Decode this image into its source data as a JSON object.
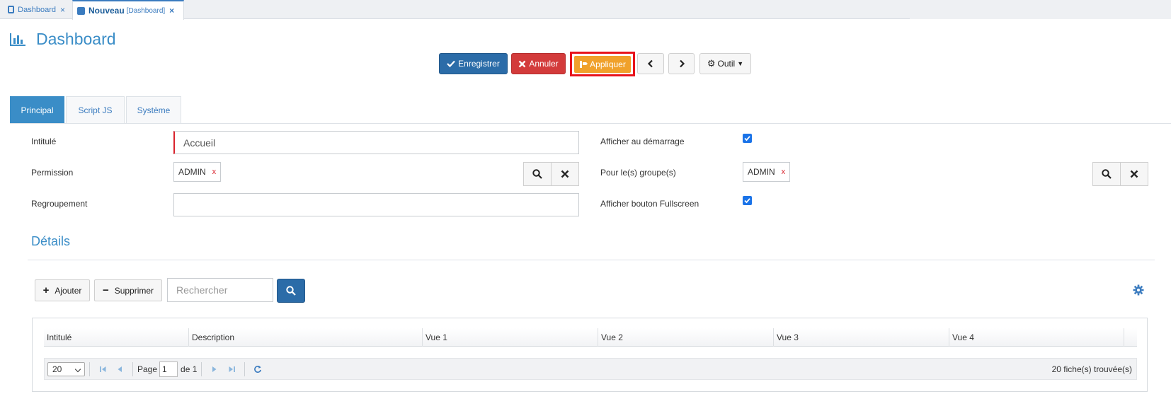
{
  "window_tabs": [
    {
      "label": "Dashboard",
      "close": "×"
    },
    {
      "label": "Nouveau",
      "sublabel": "[Dashboard]",
      "close": "×"
    }
  ],
  "page": {
    "title": "Dashboard"
  },
  "toolbar": {
    "save": "Enregistrer",
    "cancel": "Annuler",
    "apply": "Appliquer",
    "tool": "Outil"
  },
  "form_tabs": [
    "Principal",
    "Script JS",
    "Système"
  ],
  "form": {
    "intitule_label": "Intitulé",
    "intitule_value": "Accueil",
    "permission_label": "Permission",
    "permission_tag": "ADMIN",
    "regroupement_label": "Regroupement",
    "regroupement_value": "",
    "afficher_demarrage_label": "Afficher au démarrage",
    "afficher_demarrage_checked": true,
    "groupes_label": "Pour le(s) groupe(s)",
    "groupes_tag": "ADMIN",
    "fullscreen_label": "Afficher bouton Fullscreen",
    "fullscreen_checked": true,
    "tag_remove": "x"
  },
  "details": {
    "title": "Détails",
    "add": "Ajouter",
    "remove": "Supprimer",
    "search_placeholder": "Rechercher"
  },
  "grid": {
    "columns": [
      "Intitulé",
      "Description",
      "Vue 1",
      "Vue 2",
      "Vue 3",
      "Vue 4"
    ],
    "pager": {
      "page_size": "20",
      "page_label": "Page",
      "page_value": "1",
      "of_label": "de 1",
      "count": "20 fiche(s) trouvée(s)"
    }
  },
  "colors": {
    "accent": "#3a8dc7",
    "save": "#2b6ca8",
    "cancel": "#d33b3b",
    "apply": "#f0a12b",
    "highlight": "#e8141c"
  }
}
